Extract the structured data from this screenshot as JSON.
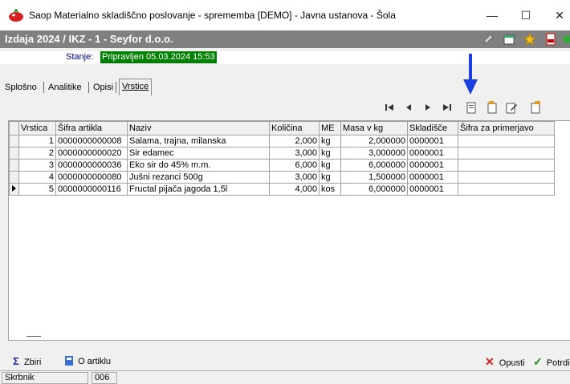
{
  "window": {
    "title": "Saop Materialno skladiščno poslovanje - sprememba [DEMO] - Javna ustanova - Šola",
    "minimize": "—",
    "maximize": "☐",
    "close": "✕"
  },
  "document": {
    "title": "Izdaja 2024 / IKZ - 1 - Seyfor d.o.o."
  },
  "status": {
    "label": "Stanje:",
    "value": "Pripravljen 05.03.2024 15:53"
  },
  "tabs": [
    "Splošno",
    "Analitike",
    "Opisi",
    "Vrstice"
  ],
  "active_tab": "Vrstice",
  "grid": {
    "columns": [
      "Vrstica",
      "Šifra artikla",
      "Naziv",
      "Količina",
      "ME",
      "Masa v kg",
      "Skladišče",
      "Šifra za primerjavo"
    ],
    "rows": [
      [
        "1",
        "0000000000008",
        "Salama, trajna, milanska",
        "2,000",
        "kg",
        "2,000000",
        "0000001",
        ""
      ],
      [
        "2",
        "0000000000020",
        "Sir edamec",
        "3,000",
        "kg",
        "3,000000",
        "0000001",
        ""
      ],
      [
        "3",
        "0000000000036",
        "Eko sir do 45% m.m.",
        "6,000",
        "kg",
        "6,000000",
        "0000001",
        ""
      ],
      [
        "4",
        "0000000000080",
        "Jušni rezanci 500g",
        "3,000",
        "kg",
        "1,500000",
        "0000001",
        ""
      ],
      [
        "5",
        "0000000000116",
        "Fructal pijača jagoda 1,5l",
        "4,000",
        "kos",
        "6,000000",
        "0000001",
        ""
      ]
    ],
    "current_row": 5
  },
  "bottom": {
    "zbiri": "Zbiri",
    "o_artiklu": "O artiklu",
    "opusti": "Opusti",
    "potrdi": "Potrdi"
  },
  "statusbar": {
    "user": "Skrbnik",
    "code": "006"
  },
  "colors": {
    "status_bg": "#008000",
    "doc_bar": "#808080",
    "arrow": "#1a3fe0"
  }
}
